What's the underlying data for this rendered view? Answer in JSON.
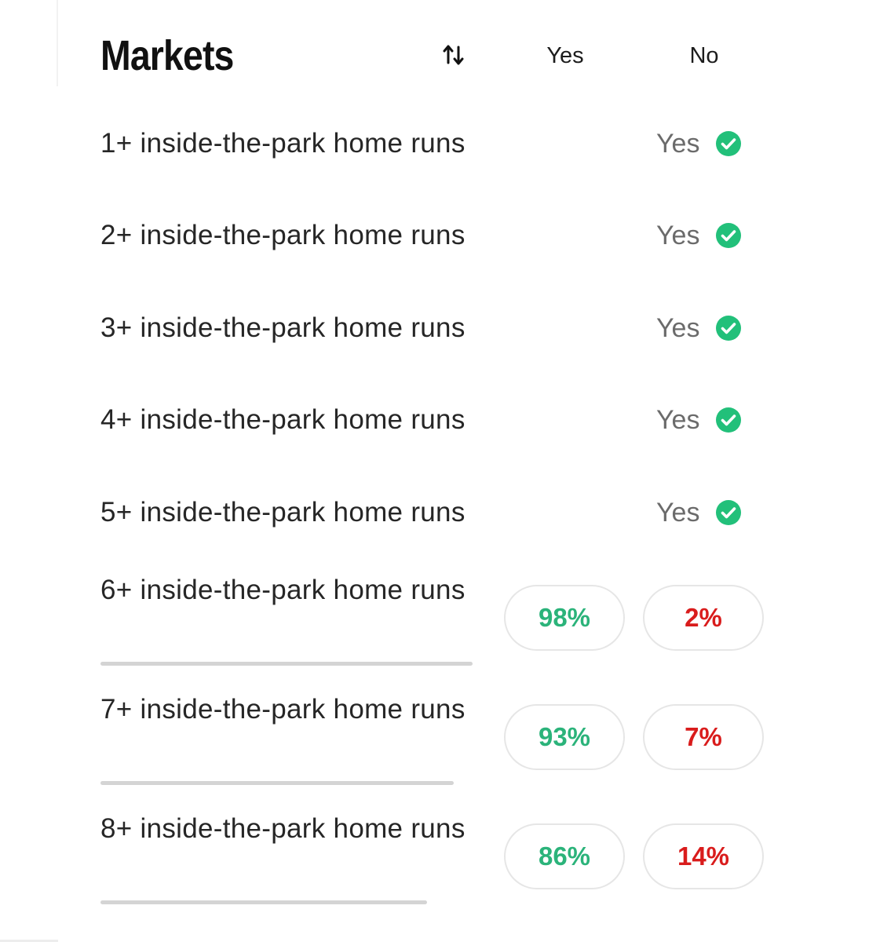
{
  "header": {
    "title": "Markets",
    "sort_icon": "sort-arrows-icon",
    "yes_label": "Yes",
    "no_label": "No"
  },
  "colors": {
    "yes_green": "#2bb37a",
    "no_red": "#d91c1c",
    "check_green": "#22c07a",
    "track_gray": "#d4d4d4"
  },
  "resolved_markets": [
    {
      "label": "1+ inside-the-park home runs",
      "outcome": "Yes",
      "icon": "check-circle-icon"
    },
    {
      "label": "2+ inside-the-park home runs",
      "outcome": "Yes",
      "icon": "check-circle-icon"
    },
    {
      "label": "3+ inside-the-park home runs",
      "outcome": "Yes",
      "icon": "check-circle-icon"
    },
    {
      "label": "4+ inside-the-park home runs",
      "outcome": "Yes",
      "icon": "check-circle-icon"
    },
    {
      "label": "5+ inside-the-park home runs",
      "outcome": "Yes",
      "icon": "check-circle-icon"
    }
  ],
  "open_markets": [
    {
      "label": "6+ inside-the-park home runs",
      "yes": "98%",
      "no": "2%",
      "progress": 1.0
    },
    {
      "label": "7+ inside-the-park home runs",
      "yes": "93%",
      "no": "7%",
      "progress": 0.95
    },
    {
      "label": "8+ inside-the-park home runs",
      "yes": "86%",
      "no": "14%",
      "progress": 0.87
    }
  ]
}
